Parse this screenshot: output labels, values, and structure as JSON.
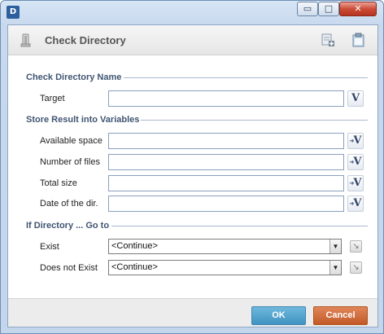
{
  "window": {
    "logo_text": "D",
    "controls": {
      "minimize": "▭",
      "maximize": "□",
      "close": "✕"
    }
  },
  "header": {
    "title": "Check Directory",
    "icon": "directory-check-icon",
    "toolbar_icons": [
      "new-item-icon",
      "paste-icon"
    ]
  },
  "sections": {
    "name": {
      "title": "Check Directory Name",
      "target_label": "Target",
      "target_value": "",
      "variable_button": "V"
    },
    "variables": {
      "title": "Store Result  into Variables",
      "fields": [
        {
          "label": "Available space",
          "value": ""
        },
        {
          "label": "Number of files",
          "value": ""
        },
        {
          "label": "Total size",
          "value": ""
        },
        {
          "label": "Date of the dir.",
          "value": ""
        }
      ],
      "variable_button": "V"
    },
    "goto": {
      "title": "If Directory ... Go to",
      "rows": [
        {
          "label": "Exist",
          "selected": "<Continue>"
        },
        {
          "label": "Does not Exist",
          "selected": "<Continue>"
        }
      ],
      "dropdown_arrow": "▼",
      "goto_icon": "↘"
    }
  },
  "footer": {
    "ok_label": "OK",
    "cancel_label": "Cancel"
  },
  "colors": {
    "ok": "#4a9bc9",
    "cancel": "#cf6a38",
    "section_title": "#3f5572"
  }
}
